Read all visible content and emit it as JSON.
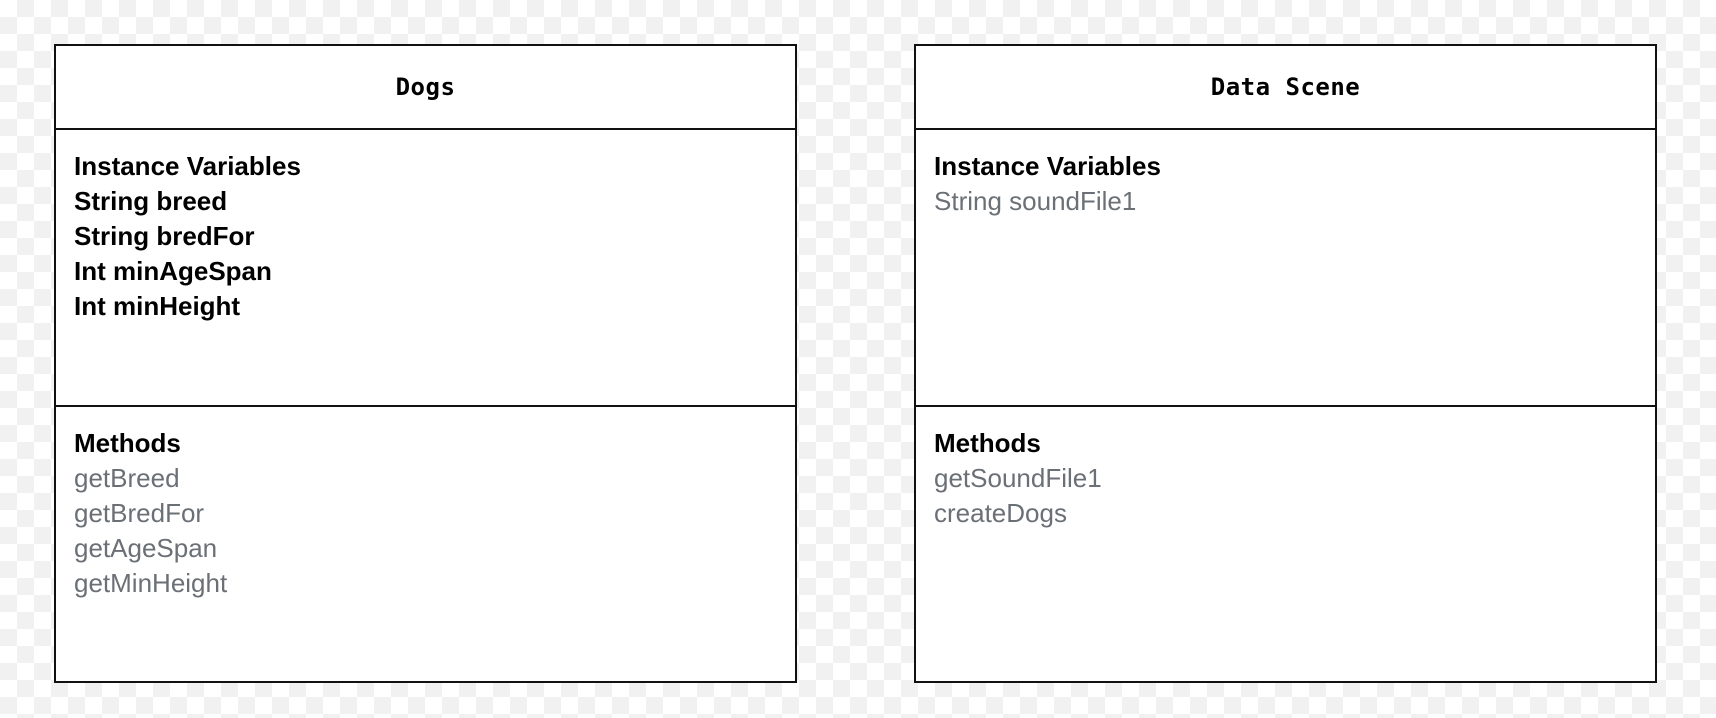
{
  "classes": [
    {
      "title": "Dogs",
      "attributes_heading": "Instance Variables",
      "attributes": [
        "String breed",
        "String bredFor",
        "Int minAgeSpan",
        "Int minHeight"
      ],
      "methods_heading": "Methods",
      "methods": [
        "getBreed",
        "getBredFor",
        "getAgeSpan",
        "getMinHeight"
      ]
    },
    {
      "title": "Data Scene",
      "attributes_heading": "Instance Variables",
      "attributes": [
        "String soundFile1"
      ],
      "methods_heading": "Methods",
      "methods": [
        "getSoundFile1",
        "createDogs"
      ]
    }
  ],
  "colors": {
    "border": "#111111",
    "heading_text": "#000000",
    "muted_text": "#6b7076",
    "background": "#ffffff",
    "checker": "#f1f1f1"
  }
}
